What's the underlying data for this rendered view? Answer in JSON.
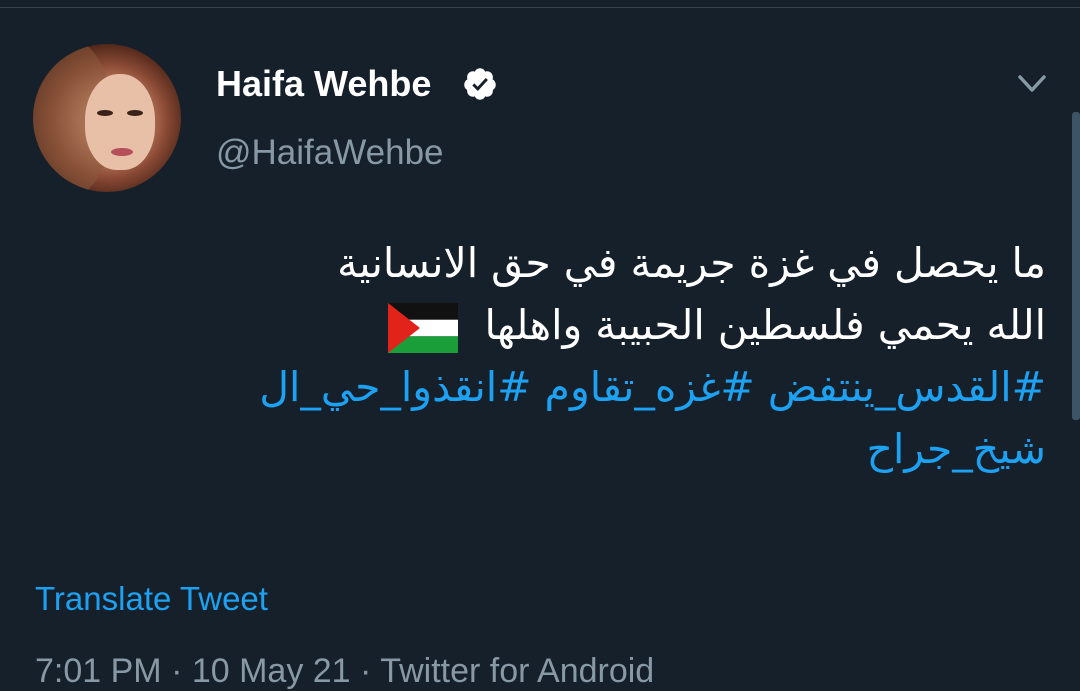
{
  "author": {
    "name": "Haifa Wehbe",
    "handle": "@HaifaWehbe",
    "verified": true,
    "verified_icon": "verified-badge-icon",
    "avatar": "profile-avatar"
  },
  "menu_icon": "chevron-down-icon",
  "tweet": {
    "line1": "ما يحصل في غزة جريمة في حق الانسانية",
    "line2": "الله يحمي فلسطين الحبيبة واهلها",
    "flag_icon": "palestine-flag-icon",
    "hashtags_line1": "#القدس_ينتفض #غزه_تقاوم #انقذوا_حي_ال",
    "hashtags_line2": "شيخ_جراح"
  },
  "translate_label": "Translate Tweet",
  "footer_partial": "7:01 PM · 10 May 21 · Twitter for Android",
  "colors": {
    "background": "#15202b",
    "text": "#ffffff",
    "secondary": "#8899a6",
    "link": "#1da1f2",
    "border": "#38444d"
  }
}
